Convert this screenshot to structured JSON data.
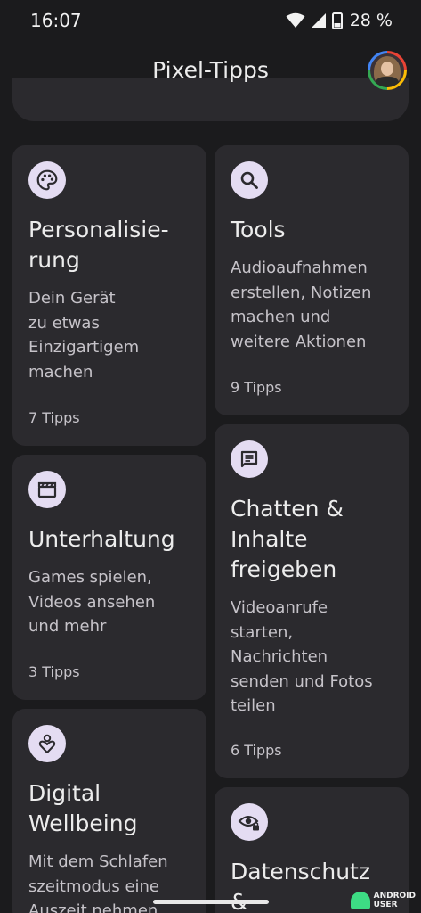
{
  "status_bar": {
    "time": "16:07",
    "battery": "28 %",
    "icons": [
      "wifi-icon",
      "signal-icon",
      "battery-icon"
    ]
  },
  "app_bar": {
    "title": "Pixel-Tipps",
    "avatar": "avatar"
  },
  "cards": {
    "personalisierung": {
      "icon": "palette-icon",
      "title": "Personalisie-\nrung",
      "desc": "Dein Gerät\nzu etwas\nEinzigartigem\nmachen",
      "count": "7 Tipps"
    },
    "tools": {
      "icon": "search-icon",
      "title": "Tools",
      "desc": "Audioaufnahmen\nerstellen, Notizen\nmachen und\nweitere Aktionen",
      "count": "9 Tipps"
    },
    "unterhaltung": {
      "icon": "clapperboard-icon",
      "title": "Unterhaltung",
      "desc": "Games spielen,\nVideos ansehen\nund mehr",
      "count": "3 Tipps"
    },
    "chatten": {
      "icon": "chat-icon",
      "title": "Chatten &\nInhalte\nfreigeben",
      "desc": "Videoanrufe\nstarten,\nNachrichten\nsenden und Fotos\nteilen",
      "count": "6 Tipps"
    },
    "wellbeing": {
      "icon": "wellbeing-icon",
      "title": "Digital\nWellbeing",
      "desc": "Mit dem Schlafen\nszeitmodus eine\nAuszeit nehmen"
    },
    "datenschutz": {
      "icon": "privacy-eye-icon",
      "title": "Datenschutz &\nSicherheit"
    }
  },
  "watermark": {
    "line1": "ANDROID",
    "line2": "USER"
  },
  "colors": {
    "background": "#1b1b1d",
    "card": "#2b2a2e",
    "icon_circle": "#e4dcf2",
    "icon_glyph": "#2b2a2e"
  }
}
